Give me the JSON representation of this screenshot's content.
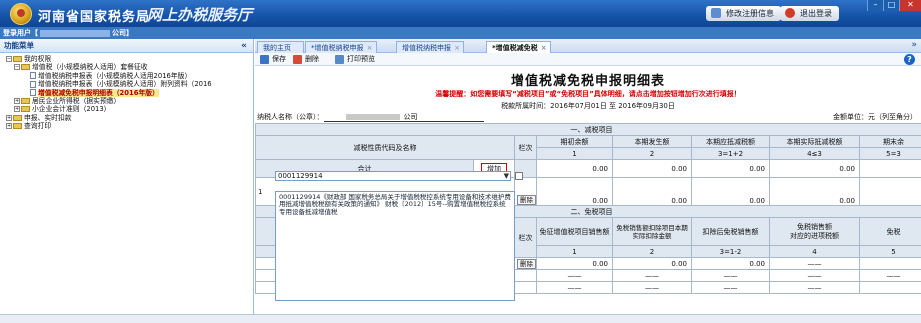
{
  "header": {
    "title": "河南省国家税务局",
    "subtitle": "网上办税服务厅",
    "modify_btn": "修改注册信息",
    "logout_btn": "退出登录",
    "win_min": "–",
    "win_max": "□",
    "win_close": "✕"
  },
  "userbar": {
    "prefix": "登录用户【",
    "suffix": "公司】"
  },
  "sidebar": {
    "title": "功能菜单",
    "collapse": "«",
    "items": [
      {
        "label": "我的权限"
      },
      {
        "label": "增值税（小规模纳税人适用）套餐征收"
      },
      {
        "label": "增值税纳税申报表（小规模纳税人适用2016年版）"
      },
      {
        "label": "增值税纳税申报表（小规模纳税人适用）附列资料（2016"
      },
      {
        "label": "增值税减免税申报明细表（2016年版）"
      },
      {
        "label": "居民企业所得税（据实预缴）"
      },
      {
        "label": "小企业会计准则（2013）"
      },
      {
        "label": "申报、实时扣款"
      },
      {
        "label": "查询打印"
      }
    ]
  },
  "tabs": [
    {
      "label": "我的主页"
    },
    {
      "label": "*增值税纳税申报"
    },
    {
      "label": "增值税纳税申报"
    },
    {
      "label": "*增值税减免税"
    }
  ],
  "toolbar": {
    "save": "保存",
    "delete": "删除",
    "print_preview": "打印预览",
    "help": "?"
  },
  "form": {
    "title": "增值税减免税申报明细表",
    "tip": "温馨提醒：如您需要填写“减税项目”或“免税项目”具体明细，请点击增加按钮增加行次进行填报！",
    "period": "税款所属时间：2016年07月01日 至 2016年09月30日",
    "taxpayer_label": "纳税人名称（公章）：",
    "taxpayer_company": "公司",
    "unit": "金额单位：元（列至角分）",
    "section1": "一、减税项目",
    "section2": "二、免税项目",
    "h1": {
      "name": "减税性质代码及名称",
      "row": "栏次",
      "c1": "期初余额",
      "c2": "本期发生额",
      "c3": "本期应抵减税额",
      "c4": "本期实际抵减税额",
      "c5": "期末余"
    },
    "h1_nums": {
      "c1": "1",
      "c2": "2",
      "c3": "3=1+2",
      "c4": "4≤3",
      "c5": "5=3"
    },
    "total_label": "合计",
    "add_btn": "增加",
    "del_btn": "删除",
    "zero": "0.00",
    "row1_index": "1",
    "row1_code": "0001129914",
    "dropdown_text": "0001129914《财政部 国家税务总局关于增值税税控系统专用设备和技术维护费用抵减增值税税额有关政策的通知》 财税〔2012〕15号--购置增值税税控系统专用设备抵减增值税",
    "h2": {
      "c1": "免征增值税项目销售额",
      "c2": "免税销售额扣除项目本期实际扣除金额",
      "c3": "扣除后免税销售额",
      "c4a": "免税销售额",
      "c4b": "对应的进项税额",
      "c5": "免税",
      "row": "栏次"
    },
    "h2_nums": {
      "c1": "1",
      "c2": "2",
      "c3": "3=1-2",
      "c4": "4",
      "c5": "5"
    },
    "dash": "——"
  }
}
